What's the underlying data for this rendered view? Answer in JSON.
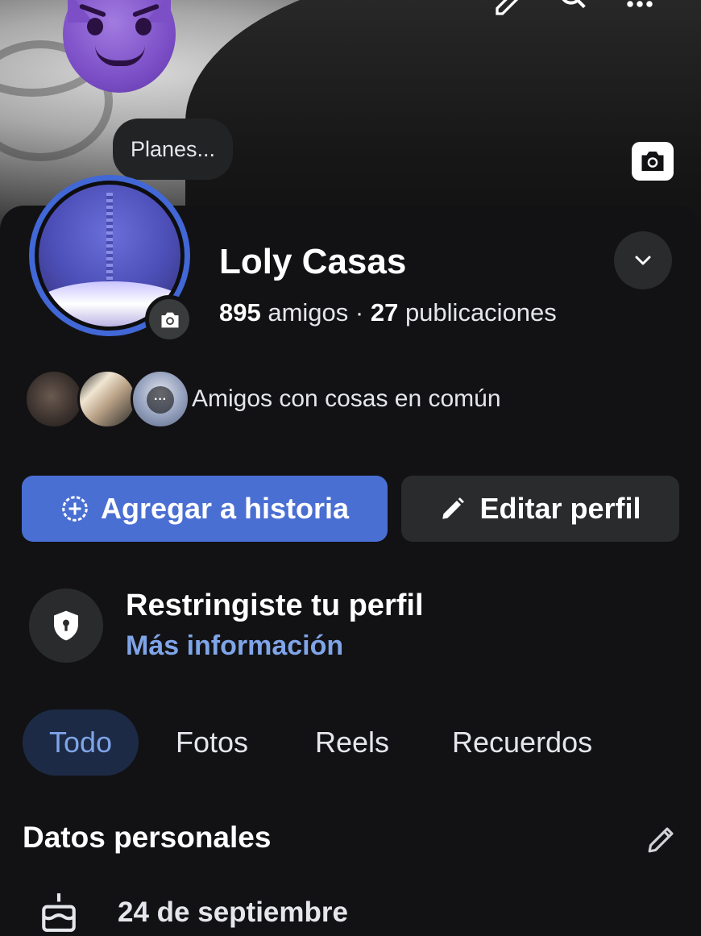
{
  "cover": {
    "status_bubble": "Planes...",
    "top_icons": [
      "edit-icon",
      "search-icon",
      "more-icon"
    ],
    "camera_icon": "camera-icon"
  },
  "profile": {
    "name": "Loly Casas",
    "friends_count": "895",
    "friends_label": " amigos · ",
    "posts_count": "27",
    "posts_label": " publicaciones",
    "mutual_text": "Amigos con cosas en común",
    "more_dots": "···"
  },
  "actions": {
    "add_story": "Agregar a historia",
    "edit_profile": "Editar perfil"
  },
  "restriction": {
    "title": "Restringiste tu perfil",
    "link": "Más información"
  },
  "tabs": [
    {
      "label": "Todo",
      "active": true
    },
    {
      "label": "Fotos",
      "active": false
    },
    {
      "label": "Reels",
      "active": false
    },
    {
      "label": "Recuerdos",
      "active": false
    }
  ],
  "personal": {
    "title": "Datos personales",
    "birthday": "24 de septiembre"
  },
  "colors": {
    "accent": "#4a6fd3",
    "link": "#7fa4e8",
    "background": "#121214"
  }
}
